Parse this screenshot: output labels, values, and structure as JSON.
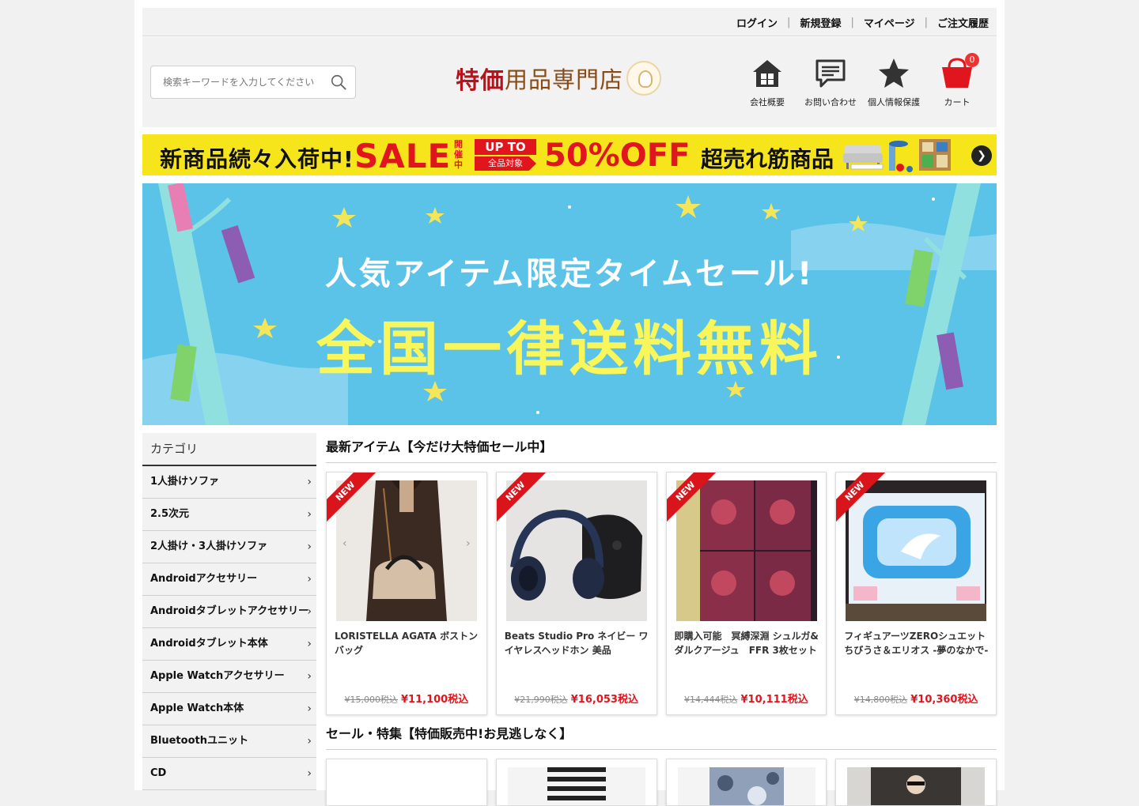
{
  "toplinks": [
    {
      "label": "ログイン"
    },
    {
      "label": "新規登録"
    },
    {
      "label": "マイページ"
    },
    {
      "label": "ご注文履歴"
    }
  ],
  "search": {
    "placeholder": "検索キーワードを入力してください",
    "icon": "search-icon"
  },
  "logo": {
    "red": "特価",
    "brown": "用品専門店"
  },
  "header_icons": [
    {
      "label": "会社概要",
      "icon": "home-icon"
    },
    {
      "label": "お問い合わせ",
      "icon": "message-icon"
    },
    {
      "label": "個人情報保護",
      "icon": "star-icon"
    },
    {
      "label": "カート",
      "icon": "cart-icon",
      "count": "0"
    }
  ],
  "banner1": {
    "lead": "新商品続々入荷中!",
    "sale": "SALE",
    "held": "開催中",
    "up_to": "UP TO",
    "all_items": "全品対象",
    "off": "50%OFF",
    "hot": "超売れ筋商品"
  },
  "banner2": {
    "line1": "人気アイテム限定タイムセール!",
    "line2": "全国一律送料無料"
  },
  "sidebar": {
    "title": "カテゴリ",
    "items": [
      {
        "label": "1人掛けソファ"
      },
      {
        "label": "2.5次元"
      },
      {
        "label": "2人掛け・3人掛けソファ"
      },
      {
        "label": "Androidアクセサリー"
      },
      {
        "label": "Androidタブレットアクセサリー"
      },
      {
        "label": "Androidタブレット本体"
      },
      {
        "label": "Apple Watchアクセサリー"
      },
      {
        "label": "Apple Watch本体"
      },
      {
        "label": "Bluetoothユニット"
      },
      {
        "label": "CD"
      }
    ]
  },
  "sections": {
    "latest_title": "最新アイテム【今だけ大特価セール中】",
    "sale_title": "セール・特集【特価販売中!お見逃しなく】"
  },
  "products": [
    {
      "badge": "NEW",
      "name": "LORISTELLA AGATA ボストンバッグ",
      "old_price": "¥15,000税込",
      "price": "¥11,100税込"
    },
    {
      "badge": "NEW",
      "name": "Beats Studio Pro ネイビー ワイヤレスヘッドホン 美品",
      "old_price": "¥21,990税込",
      "price": "¥16,053税込"
    },
    {
      "badge": "NEW",
      "name": "即購入可能　冥縛深淵 シュルガ&ダルクアージュ　FFR 3枚セット",
      "old_price": "¥14,444税込",
      "price": "¥10,111税込"
    },
    {
      "badge": "NEW",
      "name": "フィギュアーツZEROシュエット ちびうさ＆エリオス -夢のなかで-",
      "old_price": "¥14,800税込",
      "price": "¥10,360税込"
    }
  ],
  "colors": {
    "accent_red": "#e0151d",
    "banner_yellow": "#f7e51c",
    "banner_blue": "#5bc3e8"
  }
}
